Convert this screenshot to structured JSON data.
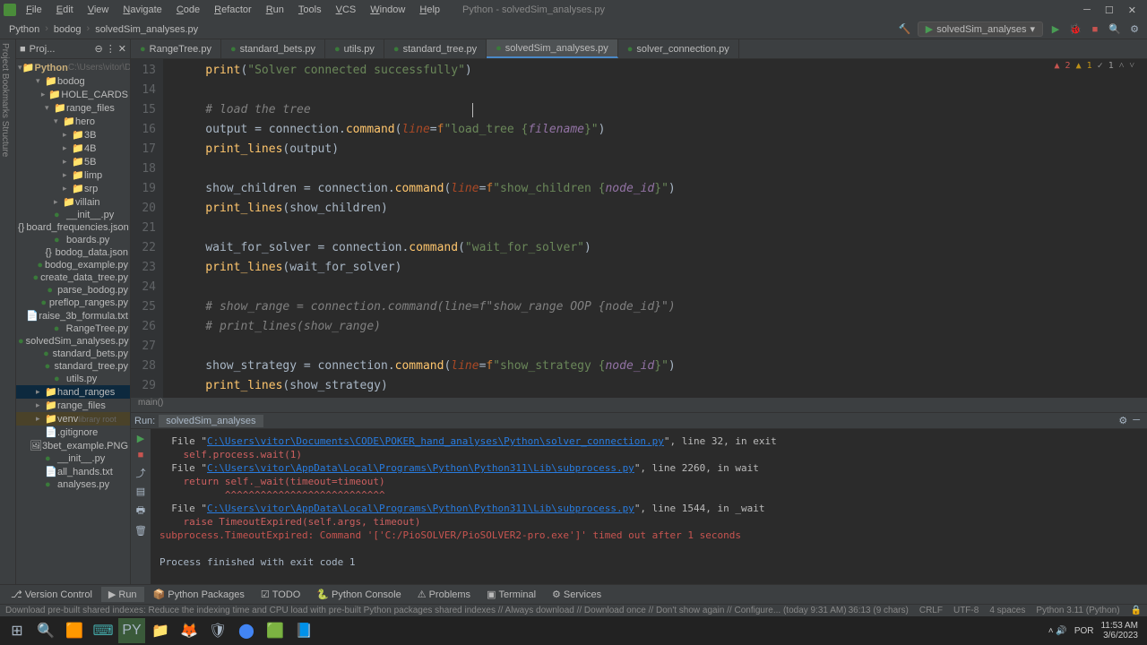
{
  "window": {
    "title": "Python - solvedSim_analyses.py"
  },
  "menu": [
    "File",
    "Edit",
    "View",
    "Navigate",
    "Code",
    "Refactor",
    "Run",
    "Tools",
    "VCS",
    "Window",
    "Help"
  ],
  "breadcrumb": [
    "Python",
    "bodog",
    "solvedSim_analyses.py"
  ],
  "runConfig": "solvedSim_analyses",
  "project": {
    "header": "Proj...",
    "root": "Python",
    "rootHint": "C:\\Users\\vitor\\Docume",
    "tree": [
      {
        "d": 1,
        "t": "folder",
        "n": "bodog",
        "exp": true
      },
      {
        "d": 2,
        "t": "folder",
        "n": "HOLE_CARDS"
      },
      {
        "d": 2,
        "t": "folder",
        "n": "range_files",
        "exp": true
      },
      {
        "d": 3,
        "t": "folder",
        "n": "hero",
        "exp": true
      },
      {
        "d": 4,
        "t": "folder",
        "n": "3B"
      },
      {
        "d": 4,
        "t": "folder",
        "n": "4B"
      },
      {
        "d": 4,
        "t": "folder",
        "n": "5B"
      },
      {
        "d": 4,
        "t": "folder",
        "n": "limp"
      },
      {
        "d": 4,
        "t": "folder",
        "n": "srp"
      },
      {
        "d": 3,
        "t": "folder",
        "n": "villain"
      },
      {
        "d": 2,
        "t": "py",
        "n": "__init__.py"
      },
      {
        "d": 2,
        "t": "json",
        "n": "board_frequencies.json"
      },
      {
        "d": 2,
        "t": "py",
        "n": "boards.py"
      },
      {
        "d": 2,
        "t": "json",
        "n": "bodog_data.json"
      },
      {
        "d": 2,
        "t": "py",
        "n": "bodog_example.py"
      },
      {
        "d": 2,
        "t": "py",
        "n": "create_data_tree.py"
      },
      {
        "d": 2,
        "t": "py",
        "n": "parse_bodog.py"
      },
      {
        "d": 2,
        "t": "py",
        "n": "preflop_ranges.py"
      },
      {
        "d": 2,
        "t": "txt",
        "n": "raise_3b_formula.txt"
      },
      {
        "d": 2,
        "t": "py",
        "n": "RangeTree.py"
      },
      {
        "d": 2,
        "t": "py",
        "n": "solvedSim_analyses.py"
      },
      {
        "d": 2,
        "t": "py",
        "n": "standard_bets.py"
      },
      {
        "d": 2,
        "t": "py",
        "n": "standard_tree.py"
      },
      {
        "d": 2,
        "t": "py",
        "n": "utils.py"
      },
      {
        "d": 1,
        "t": "folder",
        "n": "hand_ranges",
        "sel": true
      },
      {
        "d": 1,
        "t": "folder",
        "n": "range_files"
      },
      {
        "d": 1,
        "t": "venv",
        "n": "venv",
        "hint": "library root"
      },
      {
        "d": 1,
        "t": "file",
        "n": ".gitignore"
      },
      {
        "d": 1,
        "t": "img",
        "n": "3bet_example.PNG"
      },
      {
        "d": 1,
        "t": "py",
        "n": "__init__.py"
      },
      {
        "d": 1,
        "t": "txt",
        "n": "all_hands.txt"
      },
      {
        "d": 1,
        "t": "py",
        "n": "analyses.py"
      }
    ]
  },
  "tabs": [
    {
      "n": "RangeTree.py"
    },
    {
      "n": "standard_bets.py"
    },
    {
      "n": "utils.py"
    },
    {
      "n": "standard_tree.py"
    },
    {
      "n": "solvedSim_analyses.py",
      "active": true
    },
    {
      "n": "solver_connection.py"
    }
  ],
  "editor": {
    "startLine": 13,
    "lines": [
      {
        "n": 13,
        "seg": [
          {
            "c": "fn",
            "t": "    print"
          },
          {
            "c": "ident",
            "t": "("
          },
          {
            "c": "str",
            "t": "\"Solver connected successfully\""
          },
          {
            "c": "ident",
            "t": ")"
          }
        ]
      },
      {
        "n": 14,
        "seg": []
      },
      {
        "n": 15,
        "seg": [
          {
            "c": "comment",
            "t": "    # load the tree"
          }
        ],
        "cursorAfter": true
      },
      {
        "n": 16,
        "seg": [
          {
            "c": "ident",
            "t": "    output "
          },
          {
            "c": "ident",
            "t": "= "
          },
          {
            "c": "ident",
            "t": "connection."
          },
          {
            "c": "fn",
            "t": "command"
          },
          {
            "c": "ident",
            "t": "("
          },
          {
            "c": "param",
            "t": "line"
          },
          {
            "c": "ident",
            "t": "="
          },
          {
            "c": "kw",
            "t": "f"
          },
          {
            "c": "str",
            "t": "\"load_tree {"
          },
          {
            "c": "var",
            "t": "filename"
          },
          {
            "c": "str",
            "t": "}\""
          },
          {
            "c": "ident",
            "t": ")"
          }
        ]
      },
      {
        "n": 17,
        "seg": [
          {
            "c": "fn",
            "t": "    print_lines"
          },
          {
            "c": "ident",
            "t": "(output)"
          }
        ]
      },
      {
        "n": 18,
        "seg": []
      },
      {
        "n": 19,
        "seg": [
          {
            "c": "ident",
            "t": "    show_children "
          },
          {
            "c": "ident",
            "t": "= "
          },
          {
            "c": "ident",
            "t": "connection."
          },
          {
            "c": "fn",
            "t": "command"
          },
          {
            "c": "ident",
            "t": "("
          },
          {
            "c": "param",
            "t": "line"
          },
          {
            "c": "ident",
            "t": "="
          },
          {
            "c": "kw",
            "t": "f"
          },
          {
            "c": "str",
            "t": "\"show_children {"
          },
          {
            "c": "var",
            "t": "node_id"
          },
          {
            "c": "str",
            "t": "}\""
          },
          {
            "c": "ident",
            "t": ")"
          }
        ]
      },
      {
        "n": 20,
        "seg": [
          {
            "c": "fn",
            "t": "    print_lines"
          },
          {
            "c": "ident",
            "t": "(show_children)"
          }
        ]
      },
      {
        "n": 21,
        "seg": []
      },
      {
        "n": 22,
        "seg": [
          {
            "c": "ident",
            "t": "    wait_for_solver "
          },
          {
            "c": "ident",
            "t": "= "
          },
          {
            "c": "ident",
            "t": "connection."
          },
          {
            "c": "fn",
            "t": "command"
          },
          {
            "c": "ident",
            "t": "("
          },
          {
            "c": "str",
            "t": "\"wait_for_solver\""
          },
          {
            "c": "ident",
            "t": ")"
          }
        ]
      },
      {
        "n": 23,
        "seg": [
          {
            "c": "fn",
            "t": "    print_lines"
          },
          {
            "c": "ident",
            "t": "(wait_for_solver)"
          }
        ]
      },
      {
        "n": 24,
        "seg": []
      },
      {
        "n": 25,
        "seg": [
          {
            "c": "comment",
            "t": "    # show_range = connection.command(line=f\"show_range OOP {node_id}\")"
          }
        ]
      },
      {
        "n": 26,
        "seg": [
          {
            "c": "comment",
            "t": "    # print_lines(show_range)"
          }
        ]
      },
      {
        "n": 27,
        "seg": []
      },
      {
        "n": 28,
        "seg": [
          {
            "c": "ident",
            "t": "    show_strategy "
          },
          {
            "c": "ident",
            "t": "= "
          },
          {
            "c": "ident",
            "t": "connection."
          },
          {
            "c": "fn",
            "t": "command"
          },
          {
            "c": "ident",
            "t": "("
          },
          {
            "c": "param",
            "t": "line"
          },
          {
            "c": "ident",
            "t": "="
          },
          {
            "c": "kw",
            "t": "f"
          },
          {
            "c": "str",
            "t": "\"show_strategy {"
          },
          {
            "c": "var",
            "t": "node_id"
          },
          {
            "c": "str",
            "t": "}\""
          },
          {
            "c": "ident",
            "t": ")"
          }
        ]
      },
      {
        "n": 29,
        "seg": [
          {
            "c": "fn",
            "t": "    print_lines"
          },
          {
            "c": "ident",
            "t": "(show_strategy)"
          }
        ]
      },
      {
        "n": 30,
        "seg": []
      }
    ],
    "breadcrumb": "main()",
    "indicators": {
      "errors": "2",
      "warnings": "1",
      "checkmark": "✓ 1"
    }
  },
  "run": {
    "title": "Run:",
    "tab": "solvedSim_analyses",
    "console": [
      {
        "pre": "  File \"",
        "link": "C:\\Users\\vitor\\Documents\\CODE\\POKER_hand_analyses\\Python\\solver_connection.py",
        "post": "\", line 32, in exit"
      },
      {
        "trace": "    self.process.wait(1)"
      },
      {
        "pre": "  File \"",
        "link": "C:\\Users\\vitor\\AppData\\Local\\Programs\\Python\\Python311\\Lib\\subprocess.py",
        "post": "\", line 2260, in wait"
      },
      {
        "trace": "    return self._wait(timeout=timeout)"
      },
      {
        "trace": "           ^^^^^^^^^^^^^^^^^^^^^^^^^^^"
      },
      {
        "pre": "  File \"",
        "link": "C:\\Users\\vitor\\AppData\\Local\\Programs\\Python\\Python311\\Lib\\subprocess.py",
        "post": "\", line 1544, in _wait"
      },
      {
        "trace": "    raise TimeoutExpired(self.args, timeout)"
      },
      {
        "err": "subprocess.TimeoutExpired: Command '['C:/PioSOLVER/PioSOLVER2-pro.exe']' timed out after 1 seconds"
      },
      {
        "plain": ""
      },
      {
        "plain": "Process finished with exit code 1"
      }
    ]
  },
  "bottomTabs": [
    "Version Control",
    "Run",
    "Python Packages",
    "TODO",
    "Python Console",
    "Problems",
    "Terminal",
    "Services"
  ],
  "bottomActive": "Run",
  "statusMsg": "Download pre-built shared indexes: Reduce the indexing time and CPU load with pre-built Python packages shared indexes // Always download // Download once // Don't show again // Configure... (today 9:31 AM)",
  "statusRight": [
    "36:13 (9 chars)",
    "CRLF",
    "UTF-8",
    "4 spaces",
    "Python 3.11 (Python)"
  ],
  "taskbar": {
    "time": "11:53 AM",
    "date": "3/6/2023",
    "lang": "POR"
  }
}
